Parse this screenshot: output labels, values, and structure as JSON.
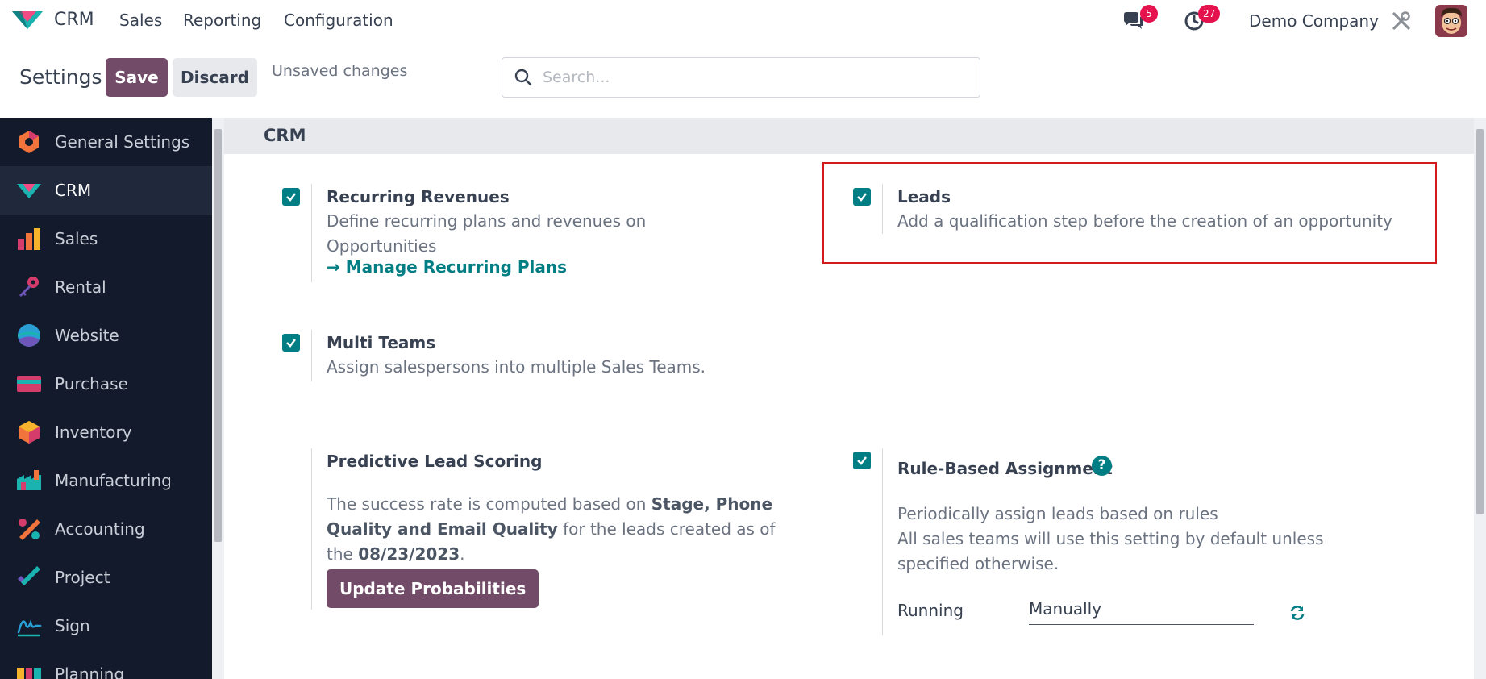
{
  "navbar": {
    "app_name": "CRM",
    "menu": [
      "Sales",
      "Reporting",
      "Configuration"
    ],
    "messages_count": "5",
    "activities_count": "27",
    "company": "Demo Company"
  },
  "control_panel": {
    "title": "Settings",
    "save_label": "Save",
    "discard_label": "Discard",
    "status": "Unsaved changes",
    "search_placeholder": "Search..."
  },
  "sidebar": {
    "items": [
      {
        "label": "General Settings",
        "icon": "general-settings-icon"
      },
      {
        "label": "CRM",
        "icon": "crm-icon",
        "active": true
      },
      {
        "label": "Sales",
        "icon": "sales-icon"
      },
      {
        "label": "Rental",
        "icon": "rental-icon"
      },
      {
        "label": "Website",
        "icon": "website-icon"
      },
      {
        "label": "Purchase",
        "icon": "purchase-icon"
      },
      {
        "label": "Inventory",
        "icon": "inventory-icon"
      },
      {
        "label": "Manufacturing",
        "icon": "manufacturing-icon"
      },
      {
        "label": "Accounting",
        "icon": "accounting-icon"
      },
      {
        "label": "Project",
        "icon": "project-icon"
      },
      {
        "label": "Sign",
        "icon": "sign-icon"
      },
      {
        "label": "Planning",
        "icon": "planning-icon"
      }
    ]
  },
  "crm": {
    "section_title": "CRM",
    "recurring_revenues": {
      "title": "Recurring Revenues",
      "description": "Define recurring plans and revenues on Opportunities",
      "link": "Manage Recurring Plans",
      "checked": true
    },
    "leads": {
      "title": "Leads",
      "description": "Add a qualification step before the creation of an opportunity",
      "checked": true
    },
    "multi_teams": {
      "title": "Multi Teams",
      "description": "Assign salespersons into multiple Sales Teams.",
      "checked": true
    },
    "predictive": {
      "title": "Predictive Lead Scoring",
      "desc_1": "The success rate is computed based on ",
      "desc_bold_1": "Stage, Phone Quality and Email Quality",
      "desc_2": " for the leads created as of the ",
      "desc_bold_2": "08/23/2023",
      "desc_3": ".",
      "button": "Update Probabilities"
    },
    "rule_based": {
      "title": "Rule-Based Assignment",
      "desc_1": "Periodically assign leads based on rules",
      "desc_2": "All sales teams will use this setting by default unless specified otherwise.",
      "running_label": "Running",
      "running_value": "Manually",
      "checked": true
    }
  },
  "colors": {
    "brand": "#714b67",
    "accent": "#017e84",
    "badge": "#e4124d",
    "sidebar_bg": "#121a2b",
    "highlight": "#d31b1b"
  }
}
